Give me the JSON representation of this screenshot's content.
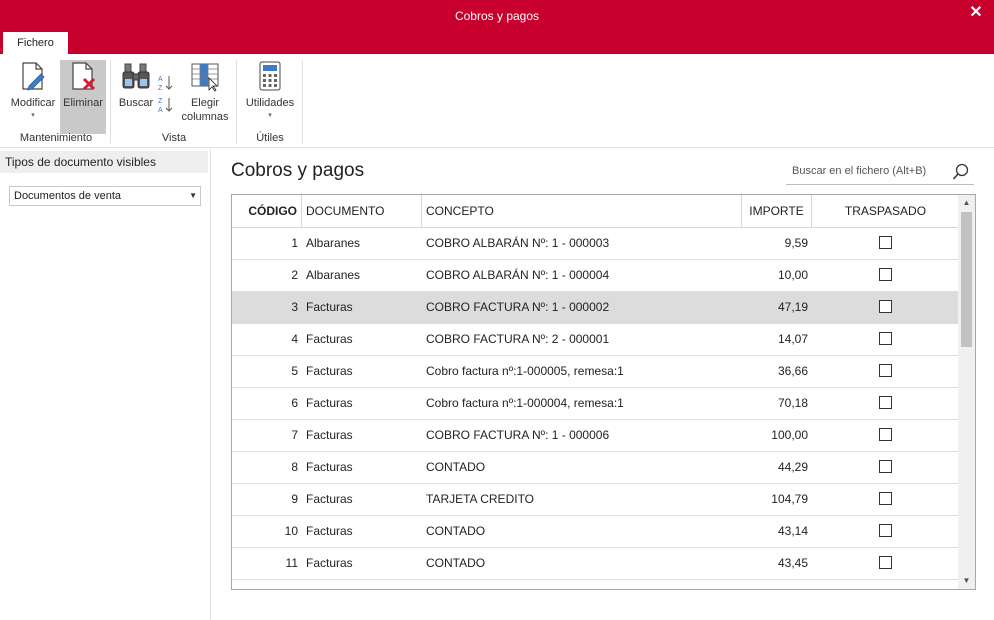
{
  "window": {
    "title": "Cobros y pagos",
    "close_glyph": "✕"
  },
  "tabs": [
    {
      "label": "Fichero"
    }
  ],
  "ribbon": {
    "groups": [
      {
        "label": "Mantenimiento"
      },
      {
        "label": "Vista"
      },
      {
        "label": "Útiles"
      }
    ],
    "buttons": {
      "modificar": "Modificar",
      "eliminar": "Eliminar",
      "buscar": "Buscar",
      "elegir_columnas_1": "Elegir",
      "elegir_columnas_2": "columnas",
      "utilidades": "Utilidades"
    },
    "caret": "▾"
  },
  "sidebar": {
    "header": "Tipos de documento visibles",
    "combo_value": "Documentos de venta",
    "combo_arrow": "▼"
  },
  "main": {
    "title": "Cobros y pagos",
    "search_placeholder": "Buscar en el fichero (Alt+B)"
  },
  "table": {
    "columns": {
      "codigo": "CÓDIGO",
      "documento": "DOCUMENTO",
      "concepto": "CONCEPTO",
      "importe": "IMPORTE",
      "traspasado": "TRASPASADO"
    },
    "rows": [
      {
        "codigo": "1",
        "documento": "Albaranes",
        "concepto": "COBRO ALBARÁN Nº: 1 - 000003",
        "importe": "9,59",
        "traspasado": false
      },
      {
        "codigo": "2",
        "documento": "Albaranes",
        "concepto": "COBRO ALBARÁN Nº: 1 - 000004",
        "importe": "10,00",
        "traspasado": false
      },
      {
        "codigo": "3",
        "documento": "Facturas",
        "concepto": "COBRO FACTURA Nº: 1 - 000002",
        "importe": "47,19",
        "traspasado": false
      },
      {
        "codigo": "4",
        "documento": "Facturas",
        "concepto": "COBRO FACTURA Nº: 2 - 000001",
        "importe": "14,07",
        "traspasado": false
      },
      {
        "codigo": "5",
        "documento": "Facturas",
        "concepto": "Cobro factura nº:1-000005, remesa:1",
        "importe": "36,66",
        "traspasado": false
      },
      {
        "codigo": "6",
        "documento": "Facturas",
        "concepto": "Cobro factura nº:1-000004, remesa:1",
        "importe": "70,18",
        "traspasado": false
      },
      {
        "codigo": "7",
        "documento": "Facturas",
        "concepto": "COBRO FACTURA Nº: 1 - 000006",
        "importe": "100,00",
        "traspasado": false
      },
      {
        "codigo": "8",
        "documento": "Facturas",
        "concepto": "CONTADO",
        "importe": "44,29",
        "traspasado": false
      },
      {
        "codigo": "9",
        "documento": "Facturas",
        "concepto": "TARJETA CREDITO",
        "importe": "104,79",
        "traspasado": false
      },
      {
        "codigo": "10",
        "documento": "Facturas",
        "concepto": "CONTADO",
        "importe": "43,14",
        "traspasado": false
      },
      {
        "codigo": "11",
        "documento": "Facturas",
        "concepto": "CONTADO",
        "importe": "43,45",
        "traspasado": false
      }
    ],
    "selected_row_index": 2
  },
  "colors": {
    "accent": "#c8002d",
    "selected_row": "#dcdcdc"
  }
}
